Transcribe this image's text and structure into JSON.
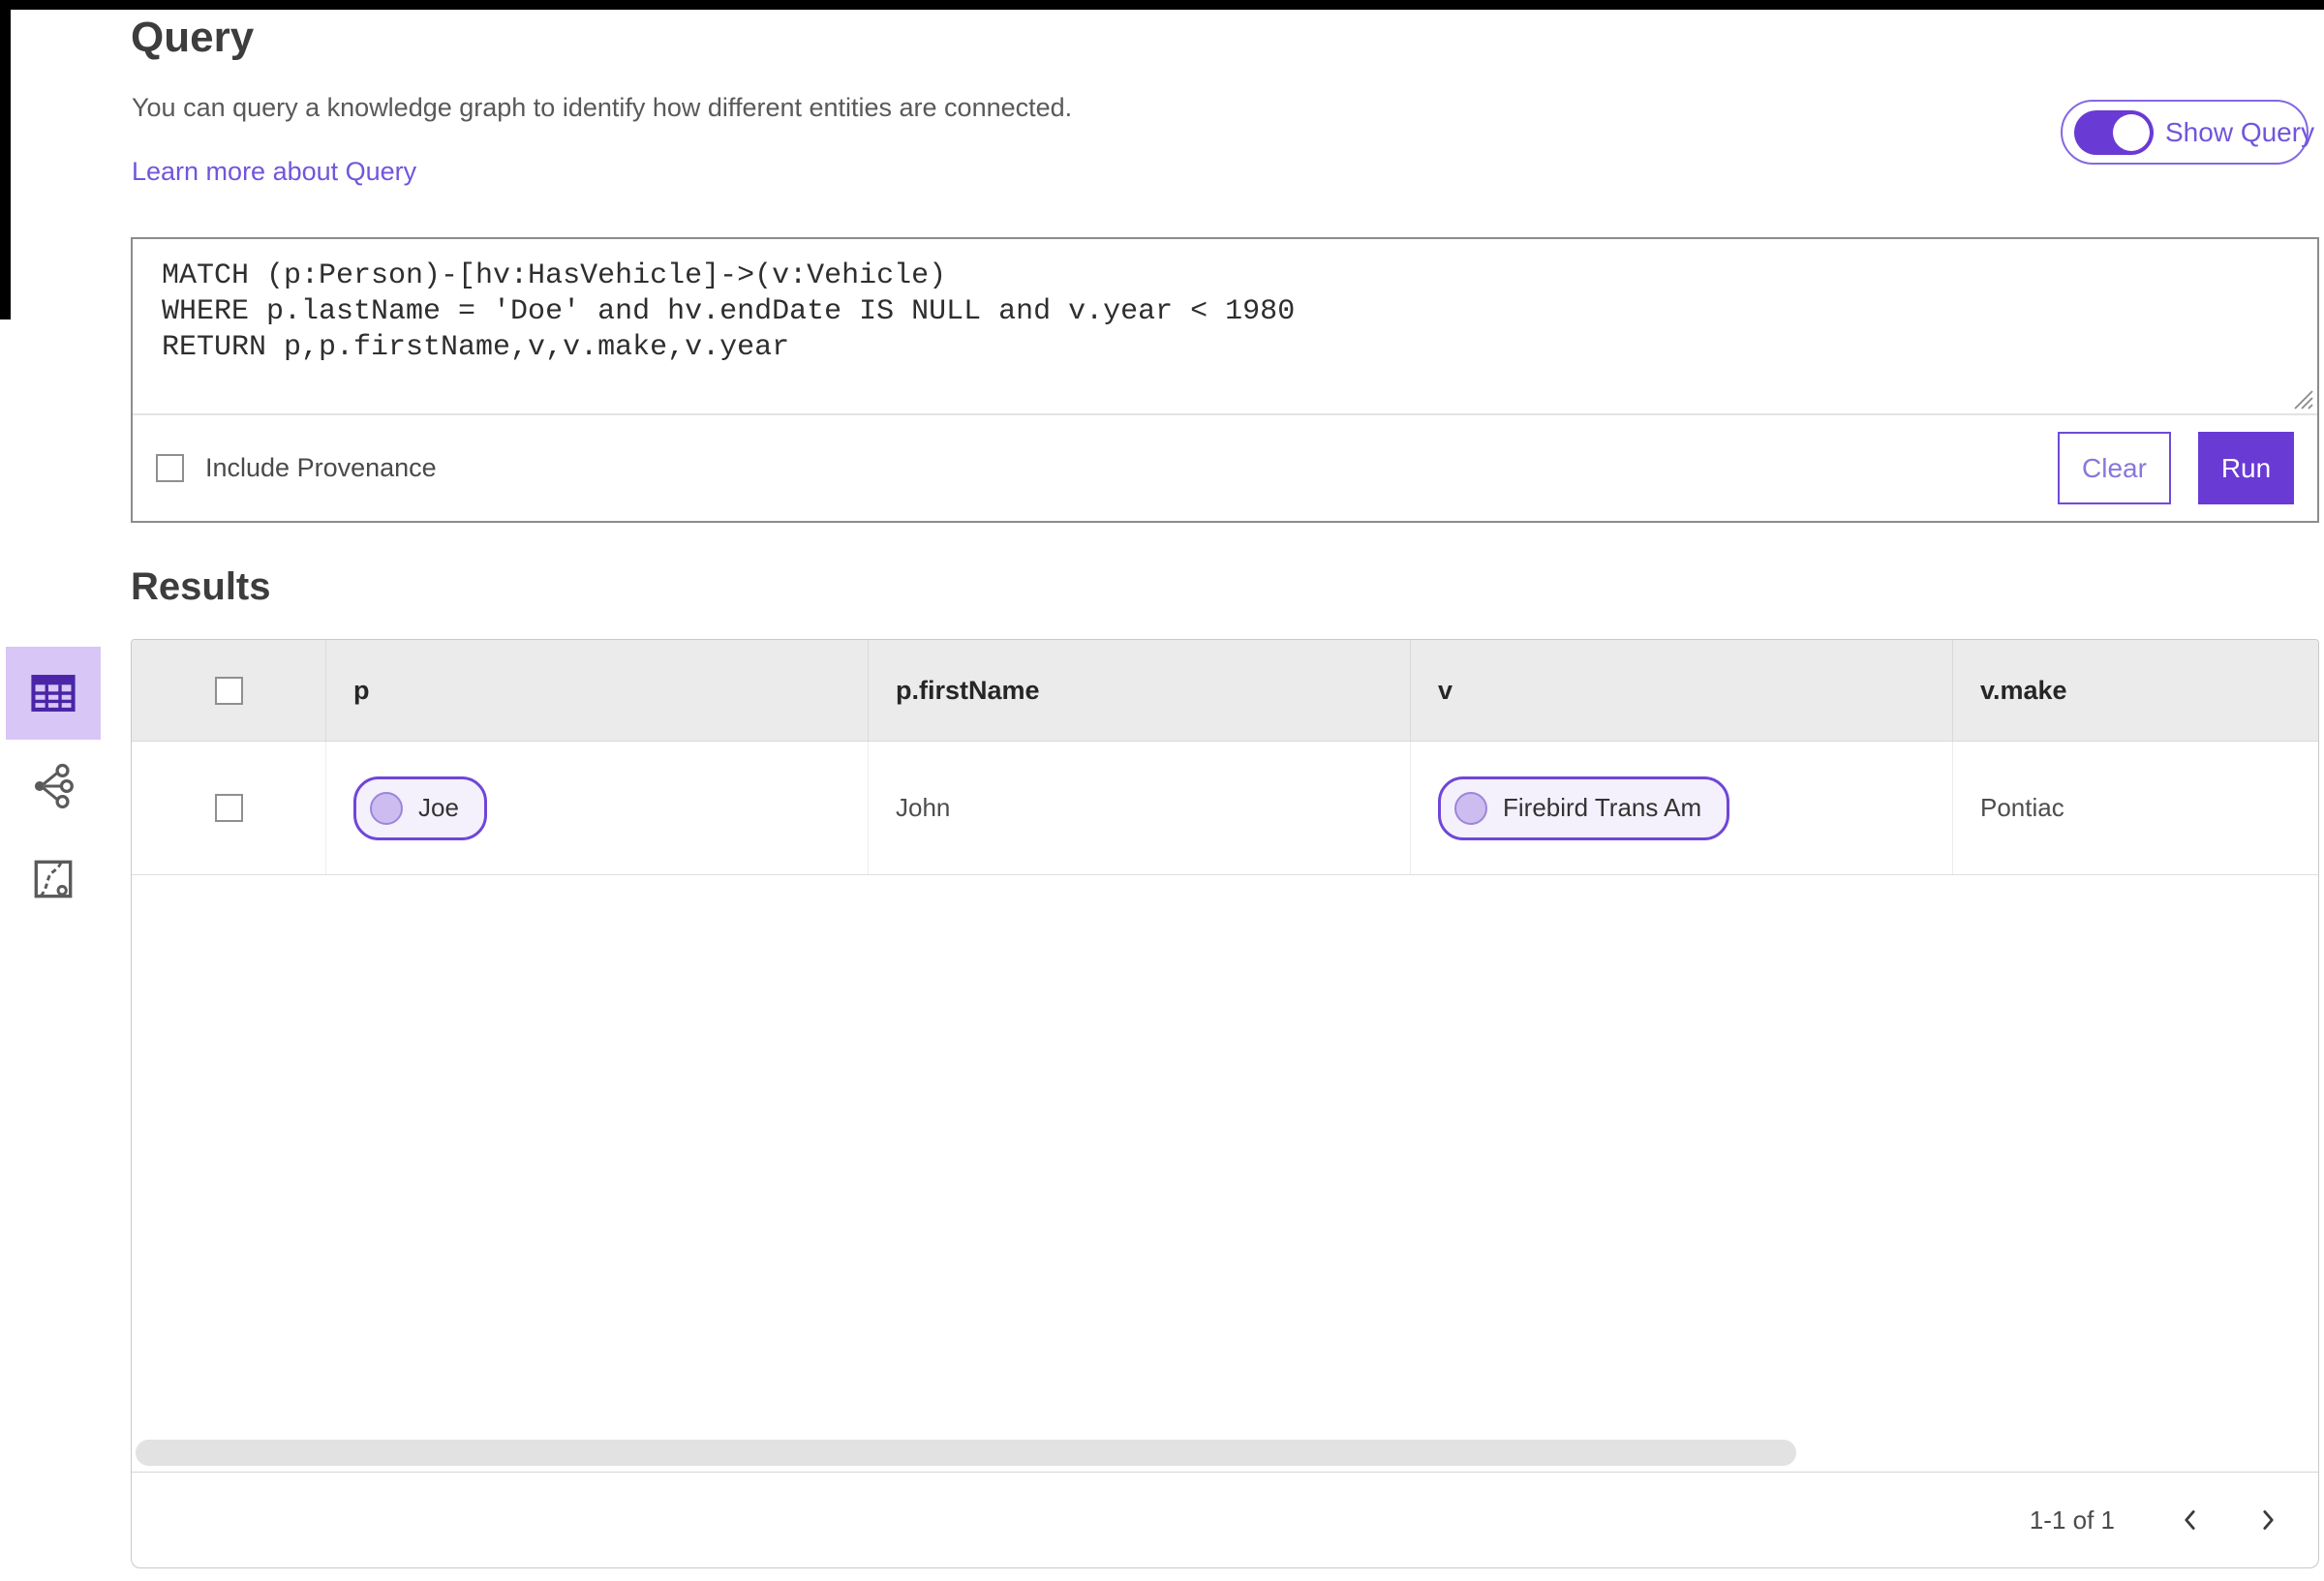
{
  "colors": {
    "accent": "#6a3ad4",
    "accent_light_bg": "#d8c6f6",
    "link": "#7155dc",
    "pill_bg": "#f4f0fc",
    "table_header_bg": "#ebebeb"
  },
  "header": {
    "title": "Query",
    "description": "You can query a knowledge graph to identify how different entities are connected.",
    "learn_more_link": "Learn more about Query",
    "show_query_toggle": {
      "label": "Show Query",
      "state": "on"
    }
  },
  "query_editor": {
    "code": "MATCH (p:Person)-[hv:HasVehicle]->(v:Vehicle)\nWHERE p.lastName = 'Doe' and hv.endDate IS NULL and v.year < 1980\nRETURN p,p.firstName,v,v.make,v.year",
    "include_provenance": {
      "label": "Include Provenance",
      "checked": false
    },
    "buttons": {
      "clear": "Clear",
      "run": "Run"
    }
  },
  "results": {
    "heading": "Results",
    "views": [
      {
        "name": "table-view",
        "icon": "table-icon",
        "selected": true
      },
      {
        "name": "graph-view",
        "icon": "network-icon",
        "selected": false
      },
      {
        "name": "map-view",
        "icon": "map-icon",
        "selected": false
      }
    ],
    "table": {
      "columns": [
        "p",
        "p.firstName",
        "v",
        "v.make"
      ],
      "rows": [
        {
          "p": "Joe",
          "p_firstName": "John",
          "v": "Firebird Trans Am",
          "v_make": "Pontiac"
        }
      ],
      "row_checkboxes_checked": false
    },
    "pagination": {
      "range_label": "1-1 of 1"
    }
  }
}
